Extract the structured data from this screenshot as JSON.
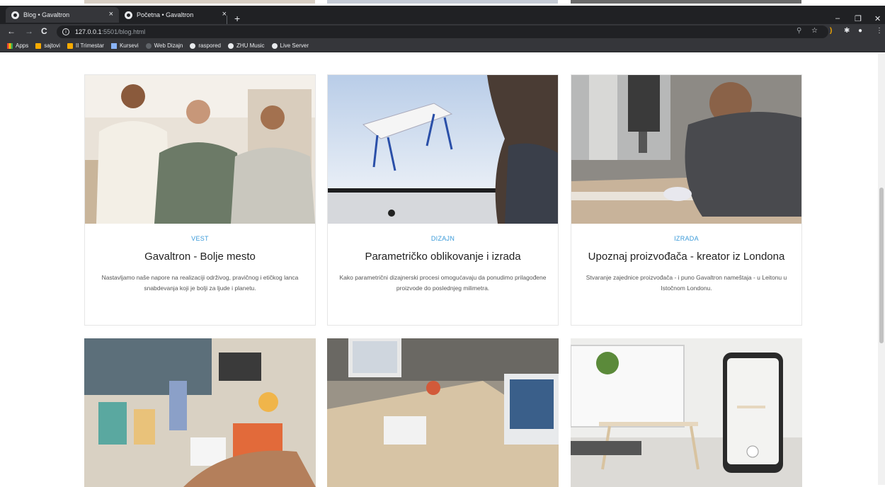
{
  "browser": {
    "tabs": [
      {
        "title": "Blog • Gavaltron",
        "active": true
      },
      {
        "title": "Početna • Gavaltron",
        "active": false
      }
    ],
    "new_tab": "+",
    "close": "×",
    "window_controls": [
      "–",
      "❐",
      "✕"
    ],
    "url_host": "127.0.0.1",
    "url_rest": ":5501/blog.html",
    "nav": {
      "back": "←",
      "forward": "→",
      "reload": "C"
    },
    "bookmarks": [
      {
        "label": "Apps",
        "icon": "apps-icon"
      },
      {
        "label": "sajtovi",
        "icon": "folder-icon"
      },
      {
        "label": "II Trimestar",
        "icon": "folder-icon"
      },
      {
        "label": "Kursevi",
        "icon": "course-icon"
      },
      {
        "label": "Web Dizajn",
        "icon": "web-icon"
      },
      {
        "label": "raspored",
        "icon": "globe-icon"
      },
      {
        "label": "ZHU Music",
        "icon": "globe-icon"
      },
      {
        "label": "Live Server",
        "icon": "globe-icon"
      }
    ]
  },
  "cards": [
    {
      "category": "VEST",
      "title": "Gavaltron - Bolje mesto",
      "description": "Nastavljamo naše napore na realizaciji održivog, pravičnog i etičkog lanca snabdevanja koji je bolji za ljude i planetu."
    },
    {
      "category": "DIZAJN",
      "title": "Parametričko oblikovanje i izrada",
      "description": "Kako parametrični dizajnerski procesi omogućavaju da ponudimo prilagođene proizvode do poslednjeg milimetra."
    },
    {
      "category": "IZRADA",
      "title": "Upoznaj proizvođača - kreator iz Londona",
      "description": "Stvaranje zajednice proizvođača - i puno Gavaltron nameštaja - u Leitonu u Istočnom Londonu."
    }
  ],
  "colors": {
    "accent": "#3a9ad9",
    "chrome_dark": "#202124",
    "chrome_mid": "#35363a"
  }
}
